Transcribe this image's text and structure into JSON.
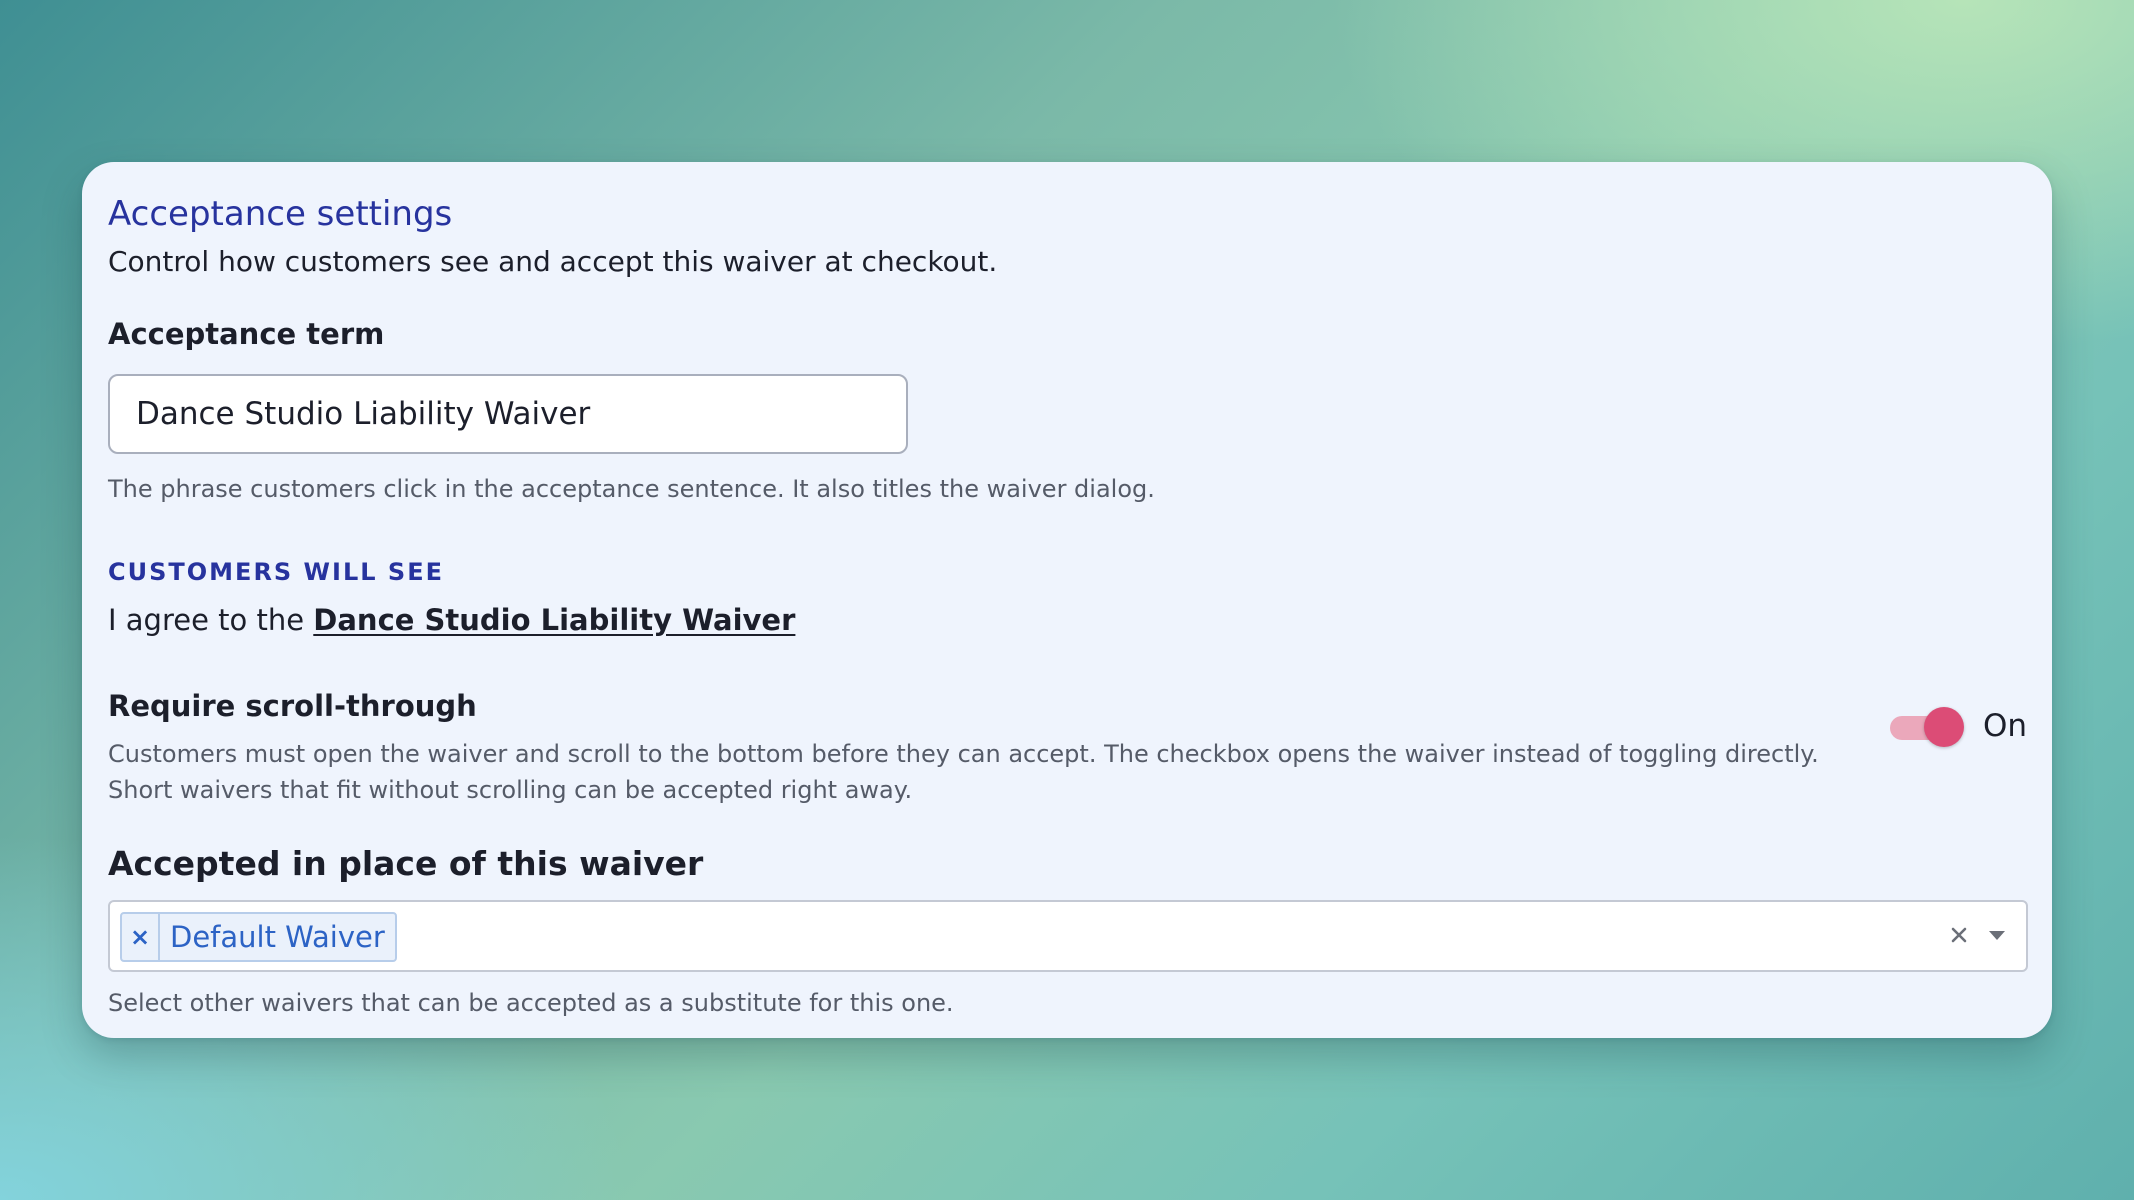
{
  "section": {
    "title": "Acceptance settings",
    "description": "Control how customers see and accept this waiver at checkout."
  },
  "acceptance_term": {
    "label": "Acceptance term",
    "value": "Dance Studio Liability Waiver",
    "help": "The phrase customers click in the acceptance sentence. It also titles the waiver dialog."
  },
  "preview": {
    "label": "CUSTOMERS WILL SEE",
    "prefix": "I agree to the ",
    "link_text": "Dance Studio Liability Waiver"
  },
  "scroll_through": {
    "label": "Require scroll-through",
    "description": "Customers must open the waiver and scroll to the bottom before they can accept. The checkbox opens the waiver instead of toggling directly. Short waivers that fit without scrolling can be accepted right away.",
    "toggle_on": true,
    "toggle_text": "On",
    "toggle_color": "#dc4c76"
  },
  "substitutes": {
    "label": "Accepted in place of this waiver",
    "selected": [
      {
        "label": "Default Waiver",
        "remove_glyph": "×"
      }
    ],
    "clear_icon": "close-icon",
    "dropdown_icon": "chevron-down-icon",
    "help": "Select other waivers that can be accepted as a substitute for this one."
  },
  "colors": {
    "accent": "#27339e",
    "chip_text": "#2c63c5",
    "card_background": "#eff4fd"
  }
}
